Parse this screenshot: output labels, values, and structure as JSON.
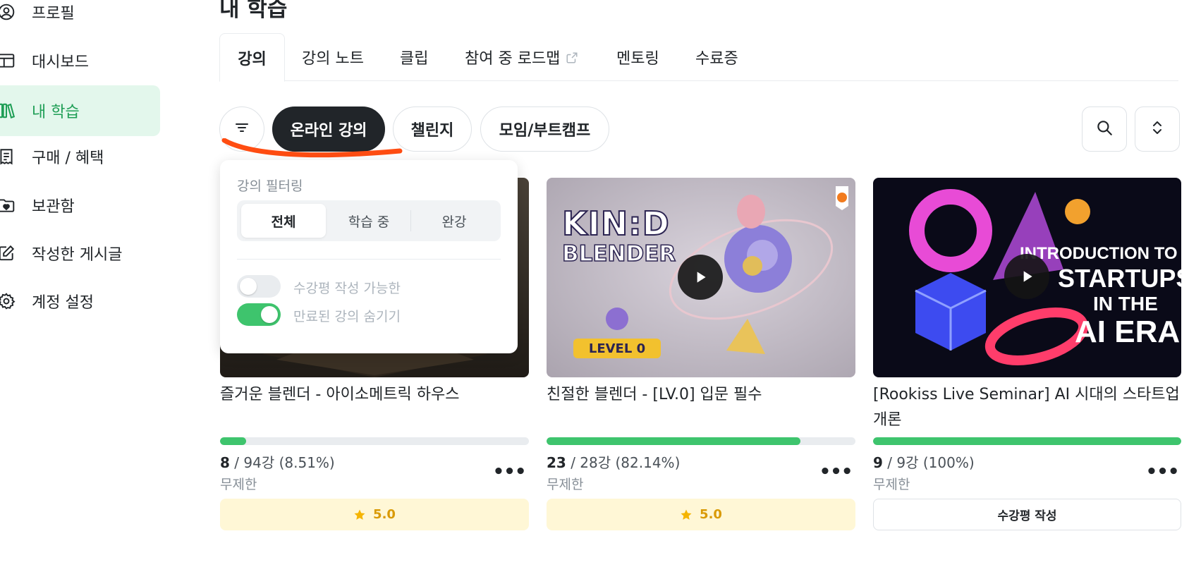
{
  "sidebar": {
    "items": [
      {
        "label": "프로필",
        "icon": "user-circle-icon"
      },
      {
        "label": "대시보드",
        "icon": "dashboard-icon"
      },
      {
        "label": "내 학습",
        "icon": "books-icon",
        "active": true
      },
      {
        "label": "구매 / 혜택",
        "icon": "receipt-icon"
      },
      {
        "label": "보관함",
        "icon": "heart-folder-icon"
      },
      {
        "label": "작성한 게시글",
        "icon": "edit-icon"
      },
      {
        "label": "계정 설정",
        "icon": "gear-icon"
      }
    ]
  },
  "page": {
    "title": "내 학습"
  },
  "tabs": [
    {
      "label": "강의",
      "active": true
    },
    {
      "label": "강의 노트"
    },
    {
      "label": "클립"
    },
    {
      "label": "참여 중 로드맵",
      "external": true
    },
    {
      "label": "멘토링"
    },
    {
      "label": "수료증"
    }
  ],
  "chips": [
    {
      "label": "온라인 강의",
      "active": true
    },
    {
      "label": "챌린지"
    },
    {
      "label": "모임/부트캠프"
    }
  ],
  "filter_popover": {
    "title": "강의 필터링",
    "segments": [
      "전체",
      "학습 중",
      "완강"
    ],
    "selected_segment": "전체",
    "toggles": [
      {
        "label": "수강평 작성 가능한",
        "on": false
      },
      {
        "label": "만료된 강의 숨기기",
        "on": true
      }
    ]
  },
  "courses": [
    {
      "title": "즐거운 블렌더 - 아이소메트릭 하우스",
      "done": "8",
      "rest": " / 94강 (8.51%)",
      "progress": 0.0851,
      "period": "무제한",
      "rating": "5.0",
      "action": "rating"
    },
    {
      "title": "친절한 블렌더 - [LV.0] 입문 필수",
      "done": "23",
      "rest": " / 28강 (82.14%)",
      "progress": 0.8214,
      "period": "무제한",
      "rating": "5.0",
      "action": "rating",
      "thumb_text": {
        "line1": "KIN:D",
        "line2": "BLENDER",
        "badge": "LEVEL 0"
      }
    },
    {
      "title": "[Rookiss Live Seminar] AI 시대의 스타트업 개론",
      "done": "9",
      "rest": " / 9강 (100%)",
      "progress": 1.0,
      "period": "무제한",
      "action": "review",
      "review_label": "수강평 작성",
      "thumb_text": {
        "line1": "INTRODUCTION TO",
        "line2": "STARTUPS",
        "line3": "IN THE",
        "line4": "AI ERA"
      }
    }
  ],
  "colors": {
    "accent_green": "#3ec46d",
    "active_bg": "#e3f7ec",
    "rating_bg": "#fff7d6",
    "star": "#f5b400",
    "annotation_red": "#ff4d12"
  }
}
